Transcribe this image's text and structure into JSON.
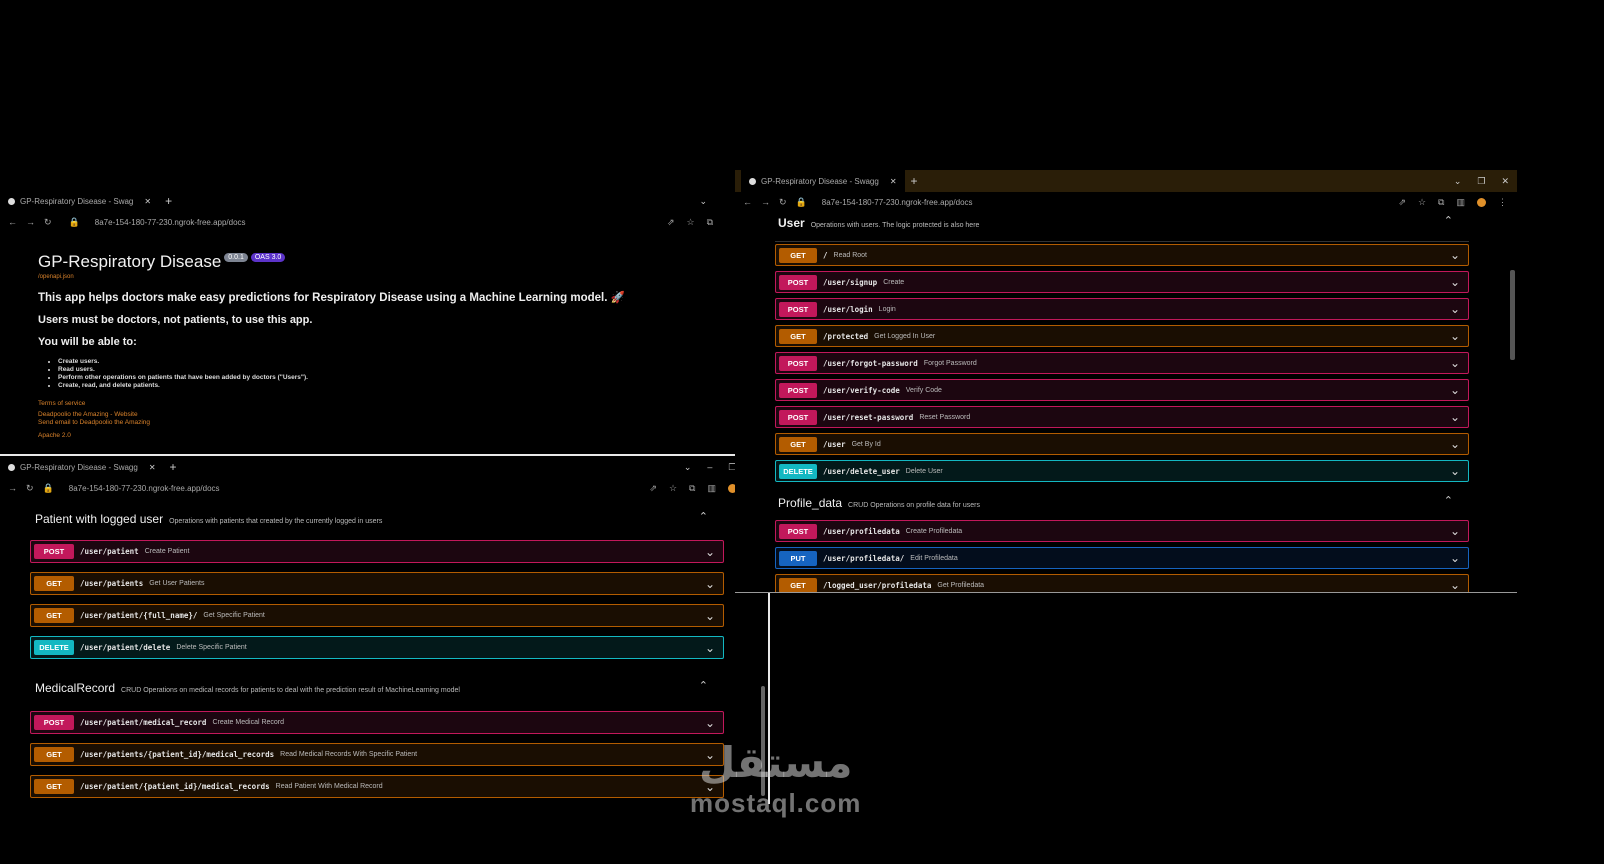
{
  "colors": {
    "post": "#c2185b",
    "get": "#b35c00",
    "delete": "#13b8c2",
    "put": "#1664c0",
    "link": "#d9822b"
  },
  "win1": {
    "tab_title": "GP-Respiratory Disease - Swag",
    "url": "8a7e-154-180-77-230.ngrok-free.app/docs",
    "title": "GP-Respiratory Disease",
    "version_badge": "0.0.1",
    "oas_badge": "OAS 3.0",
    "openapi_link": "/openapi.json",
    "desc1": "This app helps doctors make easy predictions for Respiratory Disease using a Machine Learning model. 🚀",
    "desc2": "Users must be doctors, not patients, to use this app.",
    "desc3": "You will be able to:",
    "bullets": [
      "Create users.",
      "Read users.",
      "Perform other operations on patients that have been added by doctors (\"Users\").",
      "Create, read, and delete patients."
    ],
    "terms": "Terms of service",
    "contact": "Deadpoolio the Amazing - Website",
    "email": "Send email to Deadpoolio the Amazing",
    "license": "Apache 2.0"
  },
  "win2": {
    "tab_title": "GP-Respiratory Disease - Swagg",
    "url": "8a7e-154-180-77-230.ngrok-free.app/docs",
    "sections": [
      {
        "name": "Patient with logged user",
        "desc": "Operations with patients that created by the currently logged in users",
        "ops": [
          {
            "method": "POST",
            "path": "/user/patient",
            "summary": "Create Patient"
          },
          {
            "method": "GET",
            "path": "/user/patients",
            "summary": "Get User Patients"
          },
          {
            "method": "GET",
            "path": "/user/patient/{full_name}/",
            "summary": "Get Specific Patient"
          },
          {
            "method": "DELETE",
            "path": "/user/patient/delete",
            "summary": "Delete Specific Patient"
          }
        ]
      },
      {
        "name": "MedicalRecord",
        "desc": "CRUD Operations on medical records for patients to deal with the prediction result of MachineLearning model",
        "ops": [
          {
            "method": "POST",
            "path": "/user/patient/medical_record",
            "summary": "Create Medical Record"
          },
          {
            "method": "GET",
            "path": "/user/patients/{patient_id}/medical_records",
            "summary": "Read Medical Records With Specific Patient"
          },
          {
            "method": "GET",
            "path": "/user/patient/{patient_id}/medical_records",
            "summary": "Read Patient With Medical Record"
          }
        ]
      }
    ]
  },
  "win3": {
    "tab_title": "GP-Respiratory Disease - Swagg",
    "url": "8a7e-154-180-77-230.ngrok-free.app/docs",
    "sections": [
      {
        "name": "User",
        "desc": "Operations with users. The logic protected is also here",
        "ops": [
          {
            "method": "GET",
            "path": "/",
            "summary": "Read Root"
          },
          {
            "method": "POST",
            "path": "/user/signup",
            "summary": "Create"
          },
          {
            "method": "POST",
            "path": "/user/login",
            "summary": "Login"
          },
          {
            "method": "GET",
            "path": "/protected",
            "summary": "Get Logged In User"
          },
          {
            "method": "POST",
            "path": "/user/forgot-password",
            "summary": "Forgot Password"
          },
          {
            "method": "POST",
            "path": "/user/verify-code",
            "summary": "Verify Code"
          },
          {
            "method": "POST",
            "path": "/user/reset-password",
            "summary": "Reset Password"
          },
          {
            "method": "GET",
            "path": "/user",
            "summary": "Get By Id"
          },
          {
            "method": "DELETE",
            "path": "/user/delete_user",
            "summary": "Delete User"
          }
        ]
      },
      {
        "name": "Profile_data",
        "desc": "CRUD Operations on profile data for users",
        "ops": [
          {
            "method": "POST",
            "path": "/user/profiledata",
            "summary": "Create Profiledata"
          },
          {
            "method": "PUT",
            "path": "/user/profiledata/",
            "summary": "Edit Profiledata"
          },
          {
            "method": "GET",
            "path": "/logged_user/profiledata",
            "summary": "Get Profiledata"
          }
        ]
      }
    ]
  },
  "watermark": {
    "arabic": "مستقل",
    "latin": "mostaql.com"
  }
}
